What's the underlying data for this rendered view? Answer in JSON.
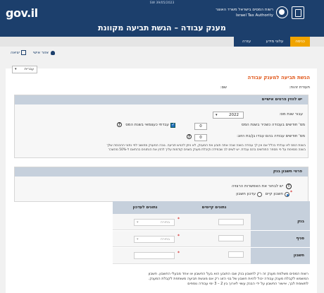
{
  "header": {
    "top_id": "SW 39/05/2023",
    "brand": "gov.il",
    "org_hebrew": "רשות המסים בישראל משרד האוצר",
    "org_english": "Israel Tax Authority",
    "page_title": "מענק עבודה – הגשת תביעה מקוונת"
  },
  "nav": {
    "tabs": [
      {
        "label": "כניסה",
        "active": true
      },
      {
        "label": "עלוני מידע",
        "active": false
      },
      {
        "label": "עזרה",
        "active": false
      }
    ]
  },
  "user_bar": {
    "user_label": "אזור אישי",
    "exit_label": "יציאה"
  },
  "language": {
    "selected": "עברית"
  },
  "form": {
    "section_title": "הגשת תביעה למענק עבודה",
    "id_label": "תעודת זהות:",
    "name_label": "שם:",
    "personal": {
      "header": "יש להזין פרטים אישיים",
      "tax_year_label": "עבור שנת מס:",
      "tax_year_value": "2022",
      "months_label": "מס' חודשים בעבודה כשכיר בשנת המס",
      "months_value": "0",
      "self_employed_label": "עבדתי כעצמאי בשנת המס",
      "children_label": "מס' חודשים עבודה בהם עבדו בן/בת הזוג:",
      "children_value": "0",
      "note_line1": "בשנת המס לא עבדתי בכלל אם אין לך עבודה בשנה שבה אתה תובע את המענק, לא ניתן להגיש תביעה. גובה המענק מחושב לפי נתוני ההכנסה שלך",
      "note_line2": "בשנה מסוימת על פי מספר החודשים בהם עבדת. יש לשים לב שבמידה וקיבלת מענק בשנים קודמות עליך להזין את הנתונים בהתאם ל-50% מהשכר"
    },
    "bank": {
      "header": "פרטי חשבון בנק",
      "choose_label": "יש לבחור את האפשרות הרצויה",
      "option_existing": "חשבון קיים",
      "option_update": "עדכון חשבון",
      "col_existing": "נתונים קיימים",
      "col_update": "נתונים לעדכון",
      "rows": [
        {
          "label": "בנק",
          "existing": "",
          "select_placeholder": "בחירה"
        },
        {
          "label": "סניף",
          "existing": "",
          "select_placeholder": "בחירה"
        },
        {
          "label": "חשבון",
          "existing": "",
          "select_placeholder": ""
        }
      ]
    },
    "footer_line1": "רשות המסים משלמת מענק זה רק לחשבון בנק שבו התובע הוא בעל החשבון או אחד מבעלי החשבון. חשבון",
    "footer_line2": "המשמש לקבלת מענק עבודה יכול להיות חשבון של בני הזוג רק אם מוגשת תביעה משותפת לקבלת המענק.",
    "footer_line3": "לתשומת לבך, אישור החשבון על ידי הבנק עשוי לארוך בין 2 – 3 ימי עבודה נוספים"
  }
}
